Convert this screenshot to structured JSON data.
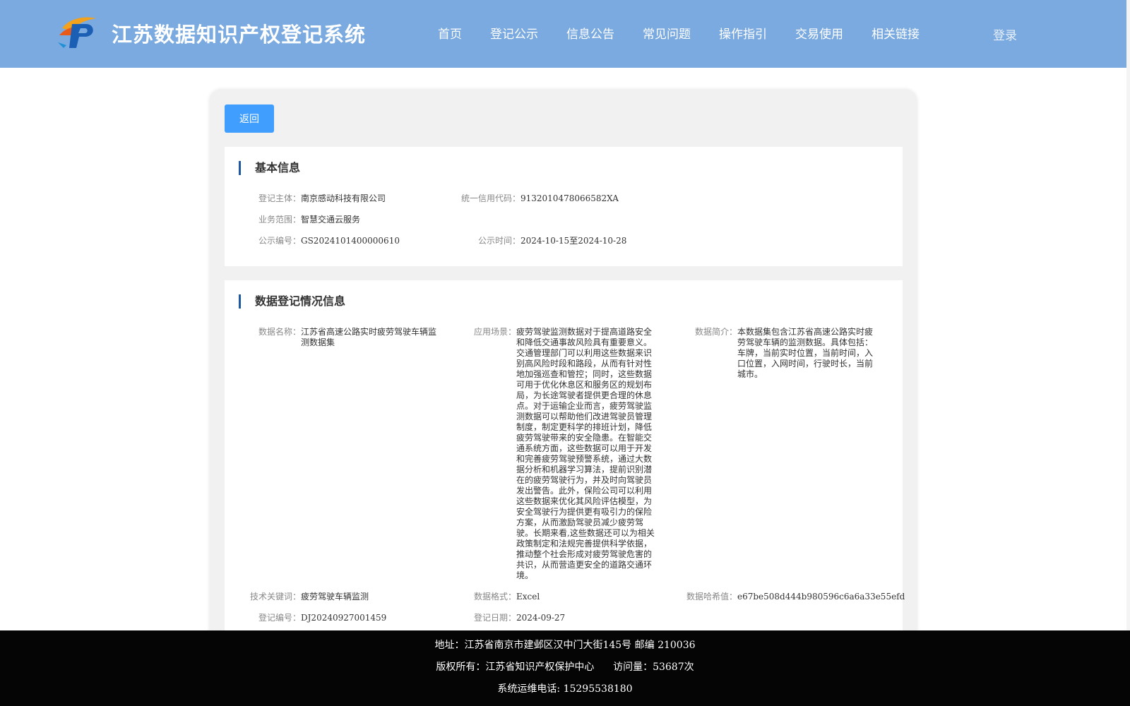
{
  "header": {
    "title": "江苏数据知识产权登记系统",
    "nav": [
      "首页",
      "登记公示",
      "信息公告",
      "常见问题",
      "操作指引",
      "交易使用",
      "相关链接"
    ],
    "login": "登录"
  },
  "back_button": "返回",
  "basic": {
    "title": "基本信息",
    "entity_label": "登记主体：",
    "entity": "南京感动科技有限公司",
    "credit_label": "统一信用代码：",
    "credit": "9132010478066582XA",
    "scope_label": "业务范围：",
    "scope": "智慧交通云服务",
    "pub_no_label": "公示编号：",
    "pub_no": "GS2024101400000610",
    "pub_time_label": "公示时间：",
    "pub_time": "2024-10-15至2024-10-28"
  },
  "registration": {
    "title": "数据登记情况信息",
    "name_label": "数据名称：",
    "name": "江苏省高速公路实时疲劳驾驶车辆监测数据集",
    "scene_label": "应用场景：",
    "scene": "疲劳驾驶监测数据对于提高道路安全和降低交通事故风险具有重要意义。交通管理部门可以利用这些数据来识别高风险时段和路段，从而有针对性地加强巡查和管控；同时，这些数据可用于优化休息区和服务区的规划布局，为长途驾驶者提供更合理的休息点。对于运输企业而言，疲劳驾驶监测数据可以帮助他们改进驾驶员管理制度，制定更科学的排班计划，降低疲劳驾驶带来的安全隐患。在智能交通系统方面，这些数据可以用于开发和完善疲劳驾驶预警系统，通过大数据分析和机器学习算法，提前识别潜在的疲劳驾驶行为，并及时向驾驶员发出警告。此外，保险公司可以利用这些数据来优化其风险评估模型，为安全驾驶行为提供更有吸引力的保险方案，从而激励驾驶员减少疲劳驾驶。长期来看,这些数据还可以为相关政策制定和法规完善提供科学依据，推动整个社会形成对疲劳驾驶危害的共识，从而营造更安全的道路交通环境。",
    "intro_label": "数据简介：",
    "intro": "本数据集包含江苏省高速公路实时疲劳驾驶车辆的监测数据。具体包括：车牌，当前实时位置，当前时间，入口位置，入网时间，行驶时长，当前城市。",
    "keyword_label": "技术关键词：",
    "keyword": "疲劳驾驶车辆监测",
    "format_label": "数据格式：",
    "format": "Excel",
    "hash_label": "数据哈希值：",
    "hash": "e67be508d444b980596c6a6a33e55efd",
    "reg_no_label": "登记编号：",
    "reg_no": "DJ20240927001459",
    "reg_date_label": "登记日期：",
    "reg_date": "2024-09-27"
  },
  "footer": {
    "address": "地址：江苏省南京市建邺区汉中门大街145号 邮编 210036",
    "copyright": "版权所有：江苏省知识产权保护中心      访问量：53687次",
    "phone": "系统运维电话: 15295538180"
  },
  "colors": {
    "header_bg": "#7aaadf",
    "button_bg": "#409eff",
    "accent_bar": "#1f5aa0",
    "footer_bg": "#050505"
  }
}
